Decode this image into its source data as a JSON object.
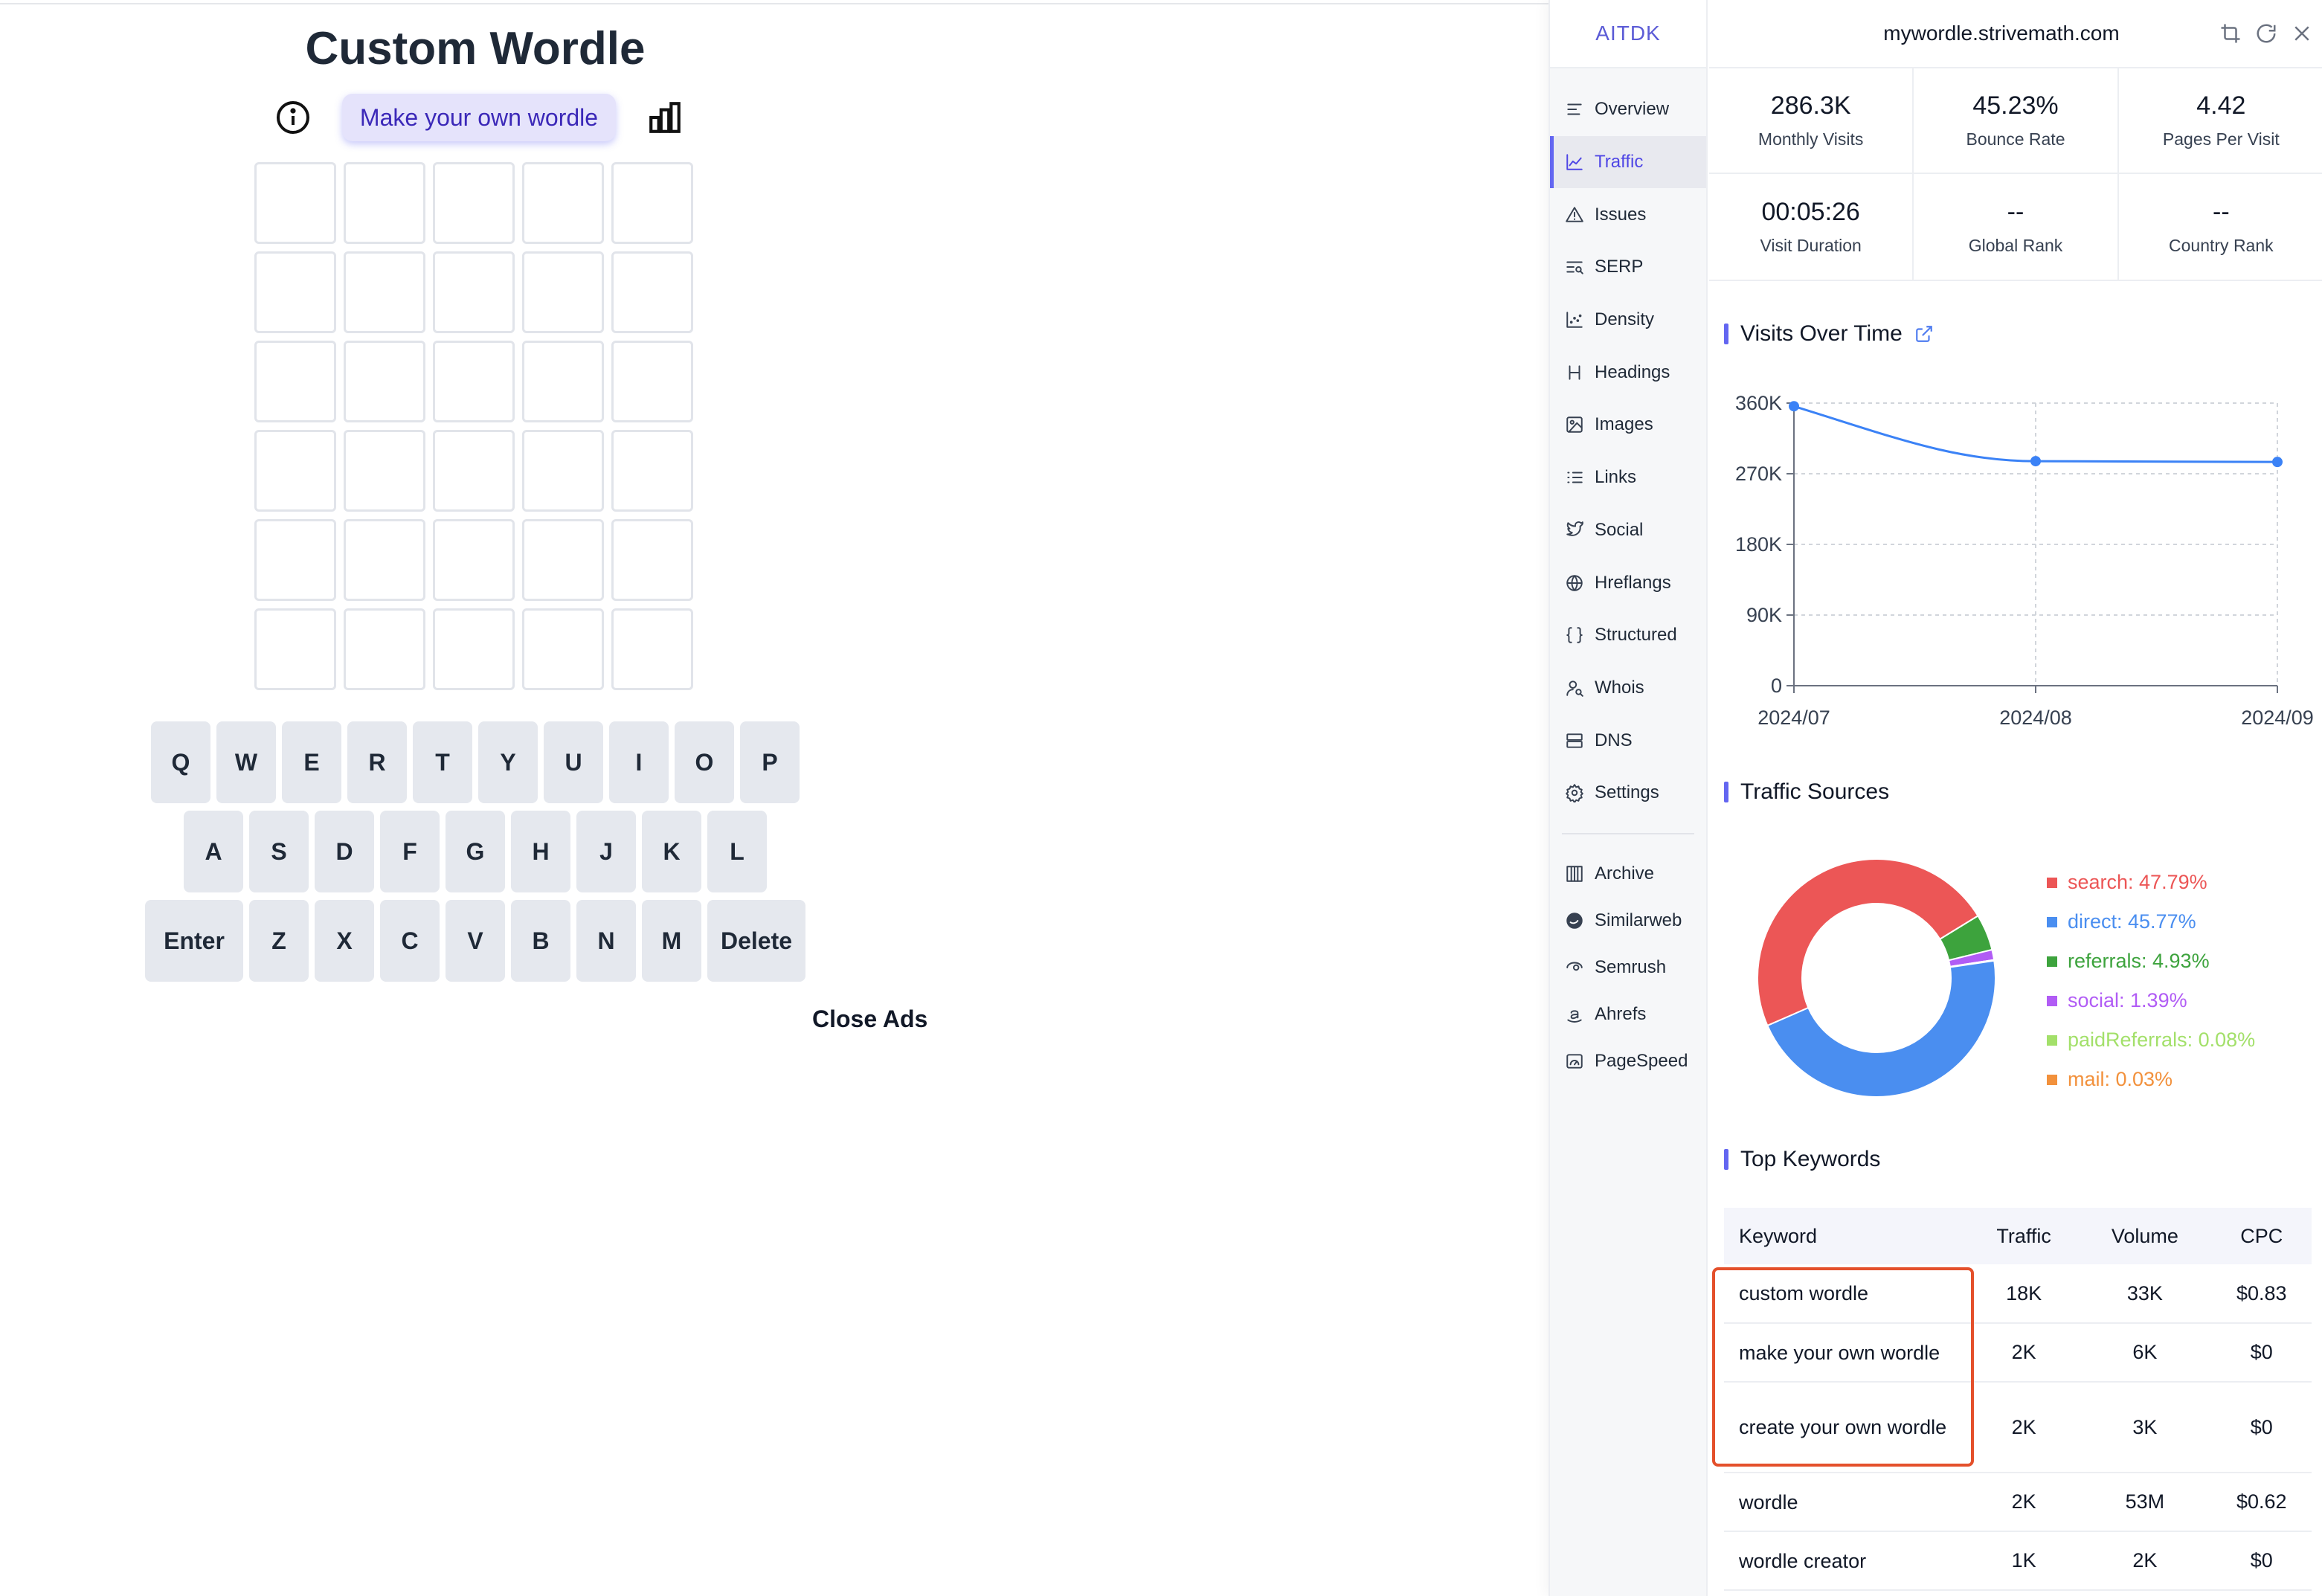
{
  "game": {
    "title": "Custom Wordle",
    "make_button": "Make your own wordle",
    "rows": 6,
    "cols": 5,
    "keyboard": [
      [
        "Q",
        "W",
        "E",
        "R",
        "T",
        "Y",
        "U",
        "I",
        "O",
        "P"
      ],
      [
        "A",
        "S",
        "D",
        "F",
        "G",
        "H",
        "J",
        "K",
        "L"
      ],
      [
        "Enter",
        "Z",
        "X",
        "C",
        "V",
        "B",
        "N",
        "M",
        "Delete"
      ]
    ],
    "close_ads": "Close Ads"
  },
  "panel": {
    "brand": "AITDK",
    "domain": "mywordle.strivemath.com",
    "nav": [
      {
        "label": "Overview",
        "icon": "overview-icon"
      },
      {
        "label": "Traffic",
        "icon": "traffic-icon",
        "active": true
      },
      {
        "label": "Issues",
        "icon": "warning-icon"
      },
      {
        "label": "SERP",
        "icon": "serp-icon"
      },
      {
        "label": "Density",
        "icon": "density-icon"
      },
      {
        "label": "Headings",
        "icon": "heading-icon"
      },
      {
        "label": "Images",
        "icon": "image-icon"
      },
      {
        "label": "Links",
        "icon": "links-icon"
      },
      {
        "label": "Social",
        "icon": "twitter-icon"
      },
      {
        "label": "Hreflangs",
        "icon": "globe-icon"
      },
      {
        "label": "Structured",
        "icon": "braces-icon"
      },
      {
        "label": "Whois",
        "icon": "user-search-icon"
      },
      {
        "label": "DNS",
        "icon": "server-icon"
      },
      {
        "label": "Settings",
        "icon": "gear-icon"
      }
    ],
    "external": [
      {
        "label": "Archive",
        "icon": "archive-icon"
      },
      {
        "label": "Similarweb",
        "icon": "similarweb-icon"
      },
      {
        "label": "Semrush",
        "icon": "semrush-icon"
      },
      {
        "label": "Ahrefs",
        "icon": "amazon-icon"
      },
      {
        "label": "PageSpeed",
        "icon": "pagespeed-icon"
      }
    ],
    "metrics": [
      {
        "value": "286.3K",
        "label": "Monthly Visits"
      },
      {
        "value": "45.23%",
        "label": "Bounce Rate"
      },
      {
        "value": "4.42",
        "label": "Pages Per Visit"
      },
      {
        "value": "00:05:26",
        "label": "Visit Duration"
      },
      {
        "value": "--",
        "label": "Global Rank"
      },
      {
        "value": "--",
        "label": "Country Rank"
      }
    ],
    "visits_title": "Visits Over Time",
    "traffic_title": "Traffic Sources",
    "keywords_title": "Top Keywords",
    "keywords": {
      "headers": [
        "Keyword",
        "Traffic",
        "Volume",
        "CPC"
      ],
      "rows": [
        [
          "custom wordle",
          "18K",
          "33K",
          "$0.83"
        ],
        [
          "make your own wordle",
          "2K",
          "6K",
          "$0"
        ],
        [
          "create your own wordle",
          "2K",
          "3K",
          "$0"
        ],
        [
          "wordle",
          "2K",
          "53M",
          "$0.62"
        ],
        [
          "wordle creator",
          "1K",
          "2K",
          "$0"
        ]
      ]
    }
  },
  "chart_data": [
    {
      "type": "line",
      "x": [
        "2024/07",
        "2024/08",
        "2024/09"
      ],
      "series": [
        {
          "values": [
            356000,
            286000,
            285000
          ]
        }
      ],
      "ylim": [
        0,
        360000
      ],
      "yticks": [
        "0",
        "90K",
        "180K",
        "270K",
        "360K"
      ],
      "grid": true,
      "color": "#3b82f6"
    },
    {
      "type": "pie",
      "donut": true,
      "labels": [
        "search: 47.79%",
        "direct: 45.77%",
        "referrals: 4.93%",
        "social: 1.39%",
        "paidReferrals: 0.08%",
        "mail: 0.03%"
      ],
      "values": [
        47.79,
        45.77,
        4.93,
        1.39,
        0.08,
        0.03
      ],
      "colors": [
        "#ec5656",
        "#4a8ef0",
        "#3da33d",
        "#b15cf5",
        "#a3e06a",
        "#f2913c"
      ],
      "legend": "right"
    }
  ]
}
